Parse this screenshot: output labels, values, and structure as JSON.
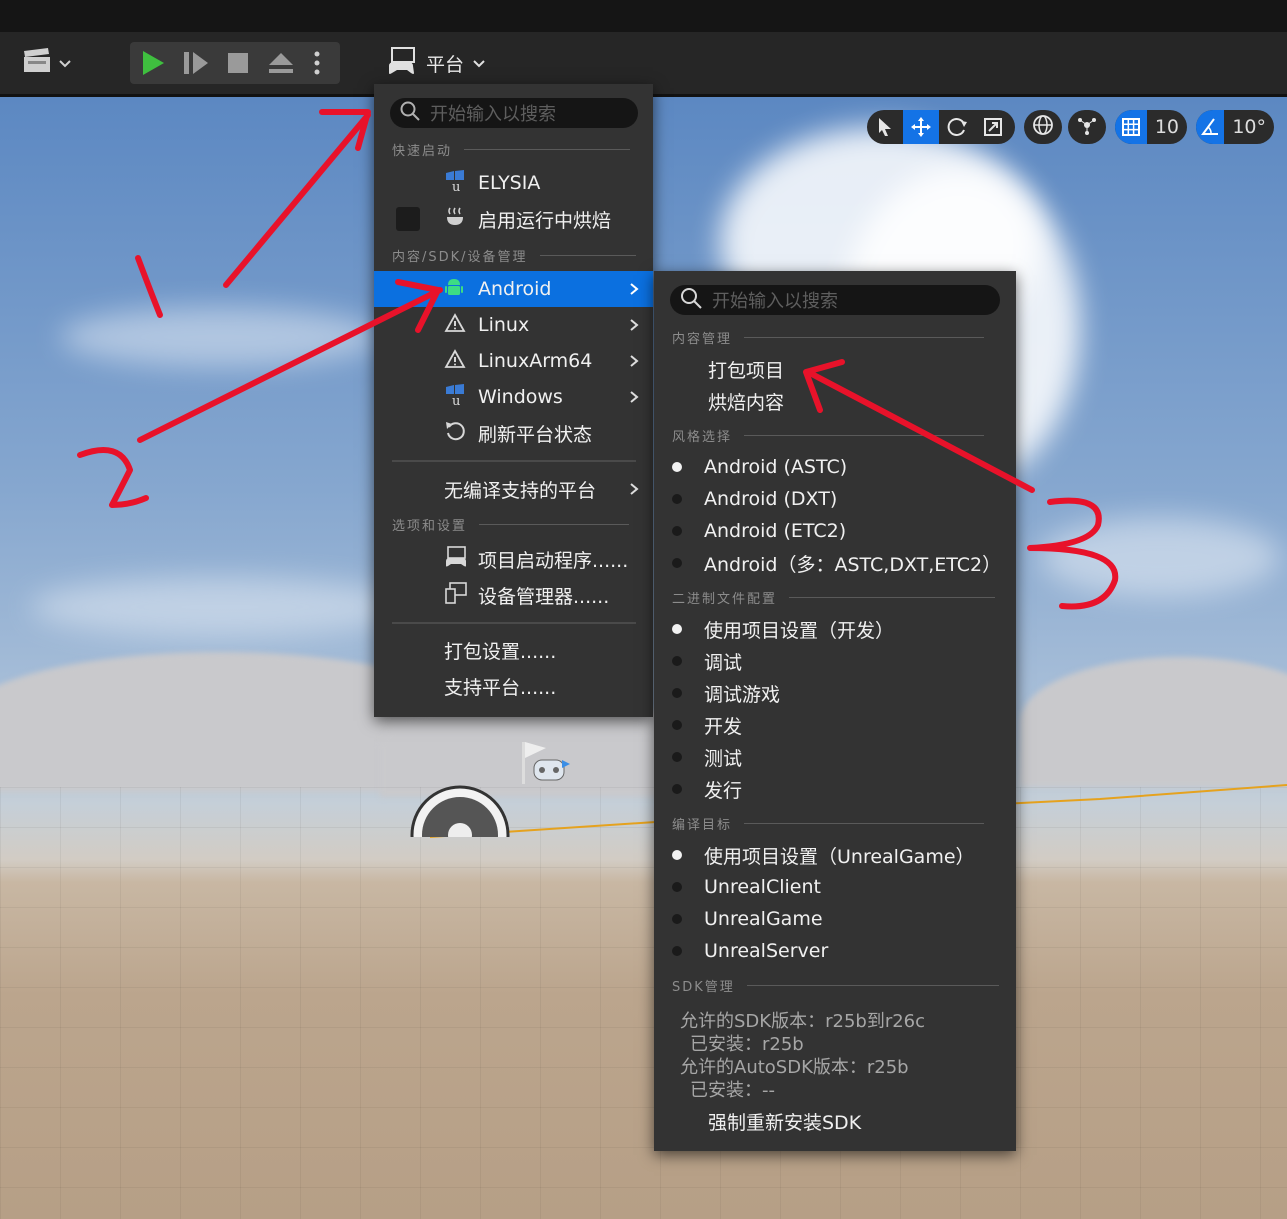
{
  "toolbar": {
    "platform_label": "平台"
  },
  "gizmo": {
    "grid_value": "10",
    "angle_value": "10°"
  },
  "platform_menu": {
    "search_placeholder": "开始输入以搜索",
    "section_quick_launch": "快速启动",
    "quick_launch_items": [
      "ELYSIA",
      "启用运行中烘焙"
    ],
    "section_content_sdk": "内容/SDK/设备管理",
    "platforms": [
      "Android",
      "Linux",
      "LinuxArm64",
      "Windows"
    ],
    "refresh_label": "刷新平台状态",
    "no_compile_label": "无编译支持的平台",
    "section_options": "选项和设置",
    "project_launcher": "项目启动程序......",
    "device_manager": "设备管理器......",
    "packaging_settings": "打包设置......",
    "supported_platforms": "支持平台......"
  },
  "android_menu": {
    "search_placeholder": "开始输入以搜索",
    "section_content": "内容管理",
    "content_items": [
      "打包项目",
      "烘焙内容"
    ],
    "section_flavor": "风格选择",
    "flavor_items": [
      "Android (ASTC)",
      "Android (DXT)",
      "Android (ETC2)",
      "Android（多：ASTC,DXT,ETC2）"
    ],
    "section_binary": "二进制文件配置",
    "binary_items": [
      "使用项目设置（开发）",
      "调试",
      "调试游戏",
      "开发",
      "测试",
      "发行"
    ],
    "section_target": "编译目标",
    "target_items": [
      "使用项目设置（UnrealGame）",
      "UnrealClient",
      "UnrealGame",
      "UnrealServer"
    ],
    "section_sdk": "SDK管理",
    "sdk_allowed": "允许的SDK版本：r25b到r26c",
    "sdk_installed": "已安装：r25b",
    "autosdk_allowed": "允许的AutoSDK版本：r25b",
    "autosdk_installed": "已安装：--",
    "force_reinstall": "强制重新安装SDK"
  },
  "colors": {
    "highlight": "#0b70e0",
    "menu_bg": "#333333",
    "annotation": "#e8122a",
    "play_green": "#3fbf3f"
  },
  "annotations": [
    "1",
    "2",
    "3"
  ]
}
